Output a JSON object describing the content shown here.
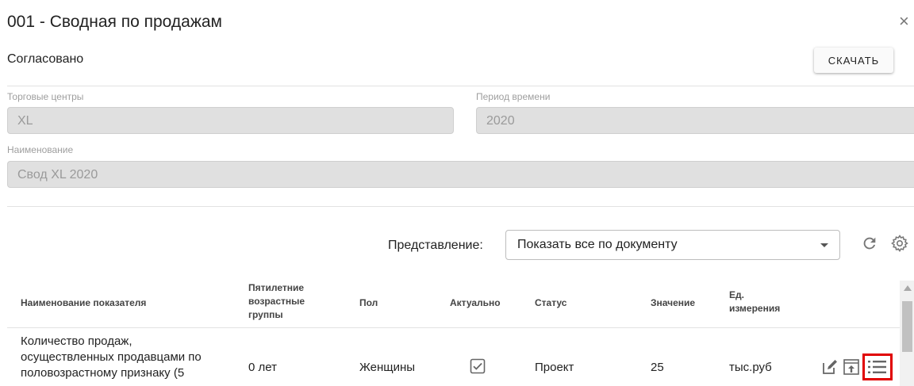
{
  "header": {
    "title": "001 - Сводная по продажам",
    "close_glyph": "×"
  },
  "status_text": "Согласовано",
  "download_label": "СКАЧАТЬ",
  "fields": {
    "trade_centers": {
      "label": "Торговые центры",
      "value": "XL"
    },
    "time_period": {
      "label": "Период времени",
      "value": "2020"
    },
    "name": {
      "label": "Наименование",
      "value": "Свод XL 2020"
    }
  },
  "view": {
    "label": "Представление:",
    "selected": "Показать все по документу"
  },
  "table": {
    "columns": {
      "indicator": "Наименование показателя",
      "age_l1": "Пятилетние",
      "age_l2": "возрастные",
      "age_l3": "группы",
      "gender": "Пол",
      "actual": "Актуально",
      "status": "Статус",
      "value": "Значение",
      "unit_l1": "Ед.",
      "unit_l2": "измерения"
    },
    "rows": [
      {
        "indicator_l1": "Количество продаж,",
        "indicator_l2": "осуществленных продавцами по",
        "indicator_l3": "половозрастному признаку (5",
        "age": "0 лет",
        "gender": "Женщины",
        "actual_checked": true,
        "status": "Проект",
        "value": "25",
        "unit": "тыс.руб"
      }
    ]
  },
  "colors": {
    "highlight": "#e00000",
    "field_bg": "#e0e0e0"
  },
  "icons": [
    "close-icon",
    "refresh-icon",
    "gear-icon",
    "edit-icon",
    "upload-icon",
    "list-icon",
    "chevron-down-icon",
    "checkbox-checked-icon"
  ]
}
